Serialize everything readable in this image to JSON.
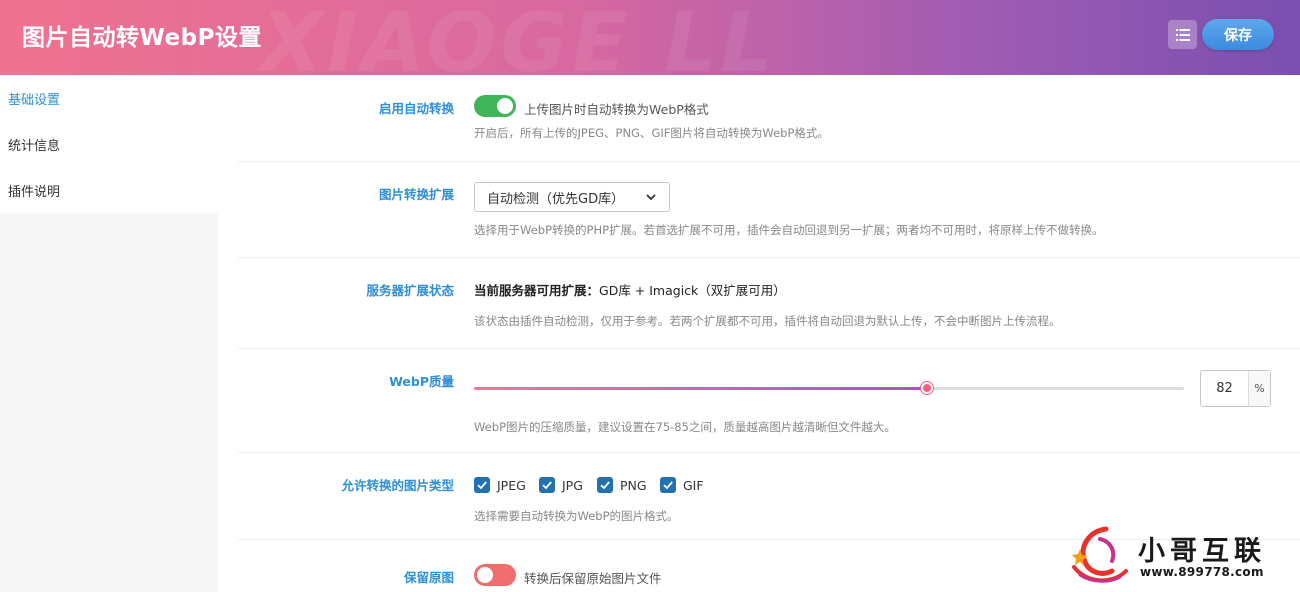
{
  "header": {
    "title": "图片自动转WebP设置",
    "save_label": "保存"
  },
  "sidebar": {
    "items": [
      {
        "label": "基础设置",
        "active": true
      },
      {
        "label": "统计信息",
        "active": false
      },
      {
        "label": "插件说明",
        "active": false
      }
    ]
  },
  "settings": {
    "enable": {
      "label": "启用自动转换",
      "toggle_on": true,
      "toggle_text": "上传图片时自动转换为WebP格式",
      "desc": "开启后，所有上传的JPEG、PNG、GIF图片将自动转换为WebP格式。"
    },
    "extension": {
      "label": "图片转换扩展",
      "selected": "自动检测（优先GD库）",
      "desc": "选择用于WebP转换的PHP扩展。若首选扩展不可用，插件会自动回退到另一扩展；两者均不可用时，将原样上传不做转换。"
    },
    "server_status": {
      "label": "服务器扩展状态",
      "status_prefix": "当前服务器可用扩展：",
      "status_value": "GD库 + Imagick（双扩展可用）",
      "desc": "该状态由插件自动检测，仅用于参考。若两个扩展都不可用，插件将自动回退为默认上传，不会中断图片上传流程。"
    },
    "quality": {
      "label": "WebP质量",
      "value": "82",
      "unit": "%",
      "desc": "WebP图片的压缩质量，建议设置在75-85之间，质量越高图片越清晰但文件越大。"
    },
    "types": {
      "label": "允许转换的图片类型",
      "options": [
        {
          "label": "JPEG",
          "checked": true
        },
        {
          "label": "JPG",
          "checked": true
        },
        {
          "label": "PNG",
          "checked": true
        },
        {
          "label": "GIF",
          "checked": true
        }
      ],
      "desc": "选择需要自动转换为WebP的图片格式。"
    },
    "keep_original": {
      "label": "保留原图",
      "toggle_on": false,
      "toggle_text": "转换后保留原始图片文件"
    }
  },
  "watermark": {
    "brand": "小哥互联",
    "url": "www.899778.com"
  },
  "colors": {
    "accent_blue": "#2f8fd6",
    "toggle_on": "#3fb55a",
    "toggle_off": "#ef6d6d",
    "checkbox": "#2271b1"
  }
}
